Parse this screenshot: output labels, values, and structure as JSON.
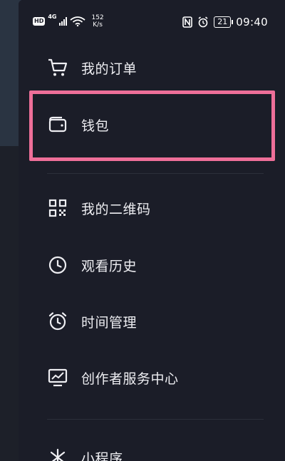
{
  "status_bar": {
    "hd": "HD",
    "network": "4G",
    "speed_value": "152",
    "speed_unit": "K/s",
    "nfc": "N",
    "battery": "21",
    "time": "09:40"
  },
  "menu": {
    "items": [
      {
        "label": "我的订单",
        "icon": "cart-icon"
      },
      {
        "label": "钱包",
        "icon": "wallet-icon"
      },
      {
        "label": "我的二维码",
        "icon": "qr-code-icon"
      },
      {
        "label": "观看历史",
        "icon": "clock-icon"
      },
      {
        "label": "时间管理",
        "icon": "alarm-clock-icon"
      },
      {
        "label": "创作者服务中心",
        "icon": "creator-chart-icon"
      },
      {
        "label": "小程序",
        "icon": "mini-program-icon"
      }
    ]
  },
  "colors": {
    "background": "#1b1d28",
    "highlight": "#ee6f99",
    "text": "#eeeef2"
  }
}
